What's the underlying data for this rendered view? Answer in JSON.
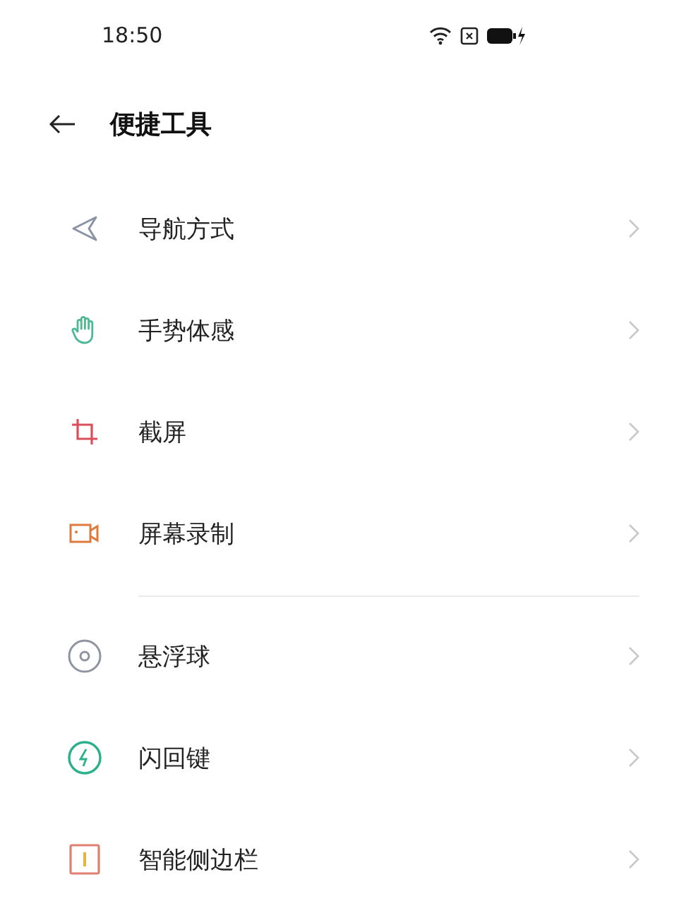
{
  "status_bar": {
    "time": "18:50"
  },
  "header": {
    "title": "便捷工具"
  },
  "groups": [
    {
      "items": [
        {
          "kind": "navigation",
          "label": "导航方式"
        },
        {
          "kind": "gesture",
          "label": "手势体感"
        },
        {
          "kind": "screenshot",
          "label": "截屏"
        },
        {
          "kind": "record",
          "label": "屏幕录制"
        }
      ]
    },
    {
      "items": [
        {
          "kind": "float",
          "label": "悬浮球"
        },
        {
          "kind": "flash",
          "label": "闪回键"
        },
        {
          "kind": "sidebar",
          "label": "智能侧边栏"
        }
      ]
    }
  ]
}
